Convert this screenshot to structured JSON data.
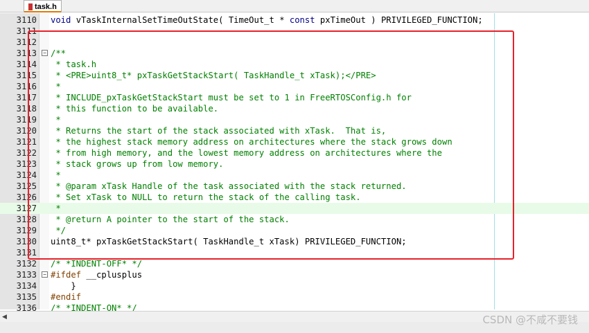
{
  "tab": {
    "label": "task.h",
    "icon": "header-file-icon"
  },
  "editor": {
    "lines": [
      {
        "num": "3110",
        "fold": "",
        "segs": [
          {
            "t": "void",
            "c": "kw"
          },
          {
            "t": " vTaskInternalSetTimeOutState( TimeOut_t * "
          },
          {
            "t": "const",
            "c": "kw"
          },
          {
            "t": " pxTimeOut ) PRIVILEGED_FUNCTION;"
          }
        ]
      },
      {
        "num": "3111",
        "fold": "",
        "segs": []
      },
      {
        "num": "3112",
        "fold": "",
        "segs": []
      },
      {
        "num": "3113",
        "fold": "−",
        "segs": [
          {
            "t": "/**",
            "c": "cmt"
          }
        ]
      },
      {
        "num": "3114",
        "fold": "",
        "segs": [
          {
            "t": " * task.h",
            "c": "cmt"
          }
        ]
      },
      {
        "num": "3115",
        "fold": "",
        "segs": [
          {
            "t": " * <PRE>uint8_t* pxTaskGetStackStart( TaskHandle_t xTask);</PRE>",
            "c": "cmt"
          }
        ]
      },
      {
        "num": "3116",
        "fold": "",
        "segs": [
          {
            "t": " *",
            "c": "cmt"
          }
        ]
      },
      {
        "num": "3117",
        "fold": "",
        "segs": [
          {
            "t": " * INCLUDE_pxTaskGetStackStart must be set to 1 in FreeRTOSConfig.h for",
            "c": "cmt"
          }
        ]
      },
      {
        "num": "3118",
        "fold": "",
        "segs": [
          {
            "t": " * this function to be available.",
            "c": "cmt"
          }
        ]
      },
      {
        "num": "3119",
        "fold": "",
        "segs": [
          {
            "t": " *",
            "c": "cmt"
          }
        ]
      },
      {
        "num": "3120",
        "fold": "",
        "segs": [
          {
            "t": " * Returns the start of the stack associated with xTask.  That is,",
            "c": "cmt"
          }
        ]
      },
      {
        "num": "3121",
        "fold": "",
        "segs": [
          {
            "t": " * the highest stack memory address on architectures where the stack grows down",
            "c": "cmt"
          }
        ]
      },
      {
        "num": "3122",
        "fold": "",
        "segs": [
          {
            "t": " * from high memory, and the lowest memory address on architectures where the",
            "c": "cmt"
          }
        ]
      },
      {
        "num": "3123",
        "fold": "",
        "segs": [
          {
            "t": " * stack grows up from low memory.",
            "c": "cmt"
          }
        ]
      },
      {
        "num": "3124",
        "fold": "",
        "segs": [
          {
            "t": " *",
            "c": "cmt"
          }
        ]
      },
      {
        "num": "3125",
        "fold": "",
        "segs": [
          {
            "t": " * @param xTask Handle of the task associated with the stack returned.",
            "c": "cmt"
          }
        ]
      },
      {
        "num": "3126",
        "fold": "",
        "segs": [
          {
            "t": " * Set xTask to NULL to return the stack of the calling task.",
            "c": "cmt"
          }
        ]
      },
      {
        "num": "3127",
        "fold": "",
        "hl": true,
        "segs": [
          {
            "t": " *",
            "c": "cmt"
          }
        ]
      },
      {
        "num": "3128",
        "fold": "",
        "segs": [
          {
            "t": " * @return A pointer to the start of the stack.",
            "c": "cmt"
          }
        ]
      },
      {
        "num": "3129",
        "fold": "",
        "segs": [
          {
            "t": " */",
            "c": "cmt"
          }
        ]
      },
      {
        "num": "3130",
        "fold": "",
        "segs": [
          {
            "t": "uint8_t* pxTaskGetStackStart( TaskHandle_t xTask) PRIVILEGED_FUNCTION;"
          }
        ]
      },
      {
        "num": "3131",
        "fold": "",
        "segs": []
      },
      {
        "num": "3132",
        "fold": "",
        "segs": [
          {
            "t": "/* *INDENT-OFF* */",
            "c": "cmt"
          }
        ]
      },
      {
        "num": "3133",
        "fold": "−",
        "segs": [
          {
            "t": "#ifdef",
            "c": "pp"
          },
          {
            "t": " __cplusplus"
          }
        ]
      },
      {
        "num": "3134",
        "fold": "",
        "segs": [
          {
            "t": "    }"
          }
        ]
      },
      {
        "num": "3135",
        "fold": "",
        "segs": [
          {
            "t": "#endif",
            "c": "pp"
          }
        ]
      },
      {
        "num": "3136",
        "fold": "",
        "segs": [
          {
            "t": "/* *INDENT-ON* */",
            "c": "cmt"
          }
        ]
      }
    ]
  },
  "scrollbar": {
    "left_arrow": "◀"
  },
  "watermark": "CSDN @不咸不要钱",
  "colors": {
    "comment": "#008000",
    "keyword": "#00008b",
    "preprocessor": "#804000",
    "highlight_box": "#e8202a",
    "current_line": "#e8fbe8"
  }
}
